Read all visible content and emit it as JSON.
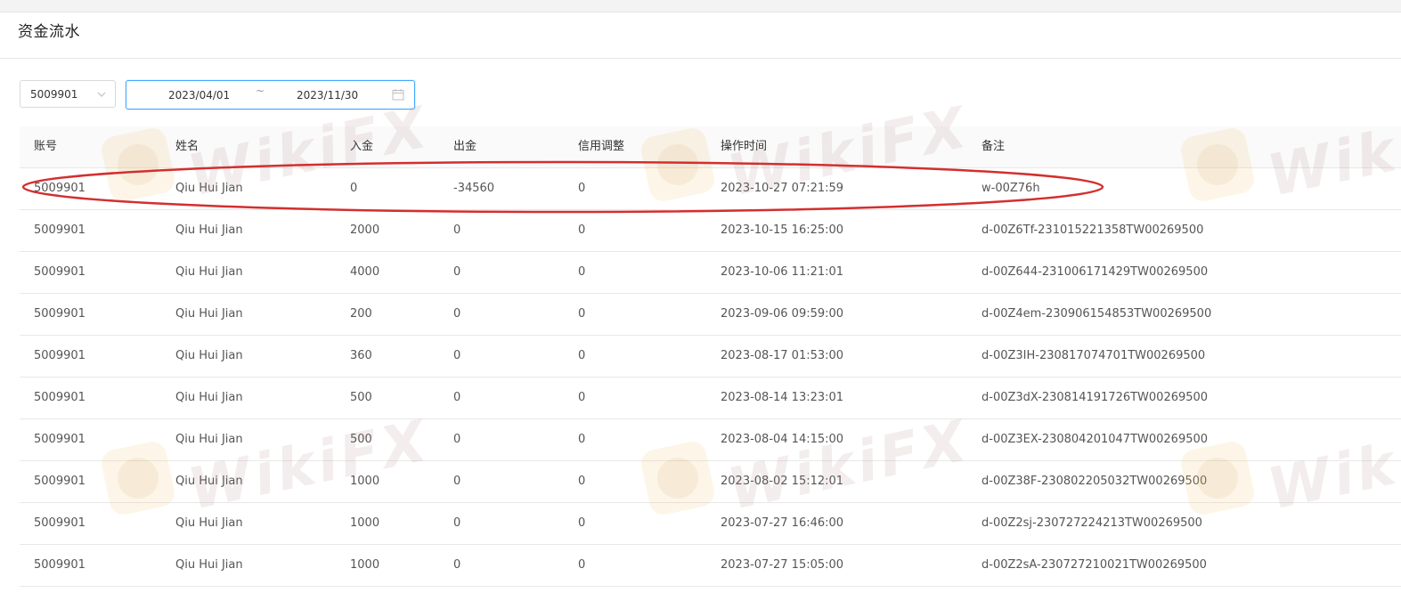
{
  "page": {
    "title": "资金流水"
  },
  "filters": {
    "account": "5009901",
    "date_start": "2023/04/01",
    "date_separator": "~",
    "date_end": "2023/11/30"
  },
  "table": {
    "columns": [
      "账号",
      "姓名",
      "入金",
      "出金",
      "信用调整",
      "操作时间",
      "备注"
    ],
    "rows": [
      [
        "5009901",
        "Qiu Hui Jian",
        "0",
        "-34560",
        "0",
        "2023-10-27 07:21:59",
        "w-00Z76h"
      ],
      [
        "5009901",
        "Qiu Hui Jian",
        "2000",
        "0",
        "0",
        "2023-10-15 16:25:00",
        "d-00Z6Tf-231015221358TW00269500"
      ],
      [
        "5009901",
        "Qiu Hui Jian",
        "4000",
        "0",
        "0",
        "2023-10-06 11:21:01",
        "d-00Z644-231006171429TW00269500"
      ],
      [
        "5009901",
        "Qiu Hui Jian",
        "200",
        "0",
        "0",
        "2023-09-06 09:59:00",
        "d-00Z4em-230906154853TW00269500"
      ],
      [
        "5009901",
        "Qiu Hui Jian",
        "360",
        "0",
        "0",
        "2023-08-17 01:53:00",
        "d-00Z3IH-230817074701TW00269500"
      ],
      [
        "5009901",
        "Qiu Hui Jian",
        "500",
        "0",
        "0",
        "2023-08-14 13:23:01",
        "d-00Z3dX-230814191726TW00269500"
      ],
      [
        "5009901",
        "Qiu Hui Jian",
        "500",
        "0",
        "0",
        "2023-08-04 14:15:00",
        "d-00Z3EX-230804201047TW00269500"
      ],
      [
        "5009901",
        "Qiu Hui Jian",
        "1000",
        "0",
        "0",
        "2023-08-02 15:12:01",
        "d-00Z38F-230802205032TW00269500"
      ],
      [
        "5009901",
        "Qiu Hui Jian",
        "1000",
        "0",
        "0",
        "2023-07-27 16:46:00",
        "d-00Z2sj-230727224213TW00269500"
      ],
      [
        "5009901",
        "Qiu Hui Jian",
        "1000",
        "0",
        "0",
        "2023-07-27 15:05:00",
        "d-00Z2sA-230727210021TW00269500"
      ]
    ]
  },
  "watermark": {
    "text": "WikiFX"
  },
  "colors": {
    "accent": "#40a9ff",
    "annotation": "#d32f2f",
    "header_bg": "#fafafa",
    "border": "#e8e8e8"
  },
  "icons": {
    "select": "chevron-down-icon",
    "date": "calendar-icon"
  }
}
